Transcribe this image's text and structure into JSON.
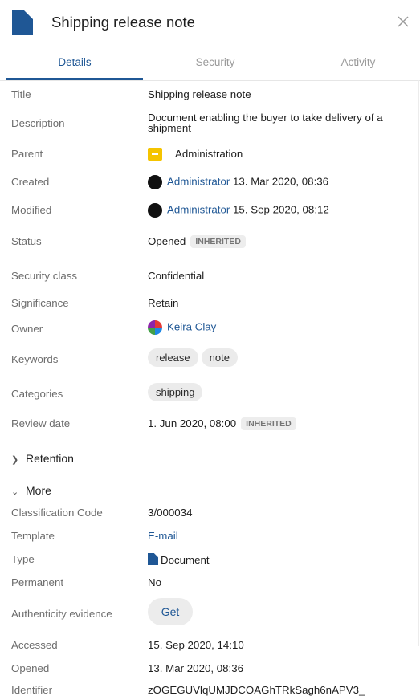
{
  "header": {
    "title": "Shipping release note"
  },
  "tabs": [
    {
      "label": "Details"
    },
    {
      "label": "Security"
    },
    {
      "label": "Activity"
    }
  ],
  "details": {
    "title": {
      "label": "Title",
      "value": "Shipping release note"
    },
    "description": {
      "label": "Description",
      "line1": "Document enabling the buyer to take delivery of a",
      "line2": "shipment"
    },
    "parent": {
      "label": "Parent",
      "value": "Administration"
    },
    "created": {
      "label": "Created",
      "user": "Administrator",
      "date": "13. Mar 2020, 08:36"
    },
    "modified": {
      "label": "Modified",
      "user": "Administrator",
      "date": "15. Sep 2020, 08:12"
    },
    "status": {
      "label": "Status",
      "value": "Opened",
      "badge": "INHERITED"
    },
    "security_class": {
      "label": "Security class",
      "value": "Confidential"
    },
    "significance": {
      "label": "Significance",
      "value": "Retain"
    },
    "owner": {
      "label": "Owner",
      "value": "Keira Clay"
    },
    "keywords": {
      "label": "Keywords",
      "items": [
        "release",
        "note"
      ]
    },
    "categories": {
      "label": "Categories",
      "items": [
        "shipping"
      ]
    },
    "review_date": {
      "label": "Review date",
      "value": "1. Jun 2020, 08:00",
      "badge": "INHERITED"
    }
  },
  "sections": {
    "retention": "Retention",
    "more": "More"
  },
  "more": {
    "classification_code": {
      "label": "Classification Code",
      "value": "3/000034"
    },
    "template": {
      "label": "Template",
      "value": "E-mail"
    },
    "type": {
      "label": "Type",
      "value": "Document"
    },
    "permanent": {
      "label": "Permanent",
      "value": "No"
    },
    "authenticity": {
      "label": "Authenticity evidence",
      "button": "Get"
    },
    "accessed": {
      "label": "Accessed",
      "value": "15. Sep 2020, 14:10"
    },
    "opened": {
      "label": "Opened",
      "value": "13. Mar 2020, 08:36"
    },
    "identifier": {
      "label": "Identifier",
      "value": "zOGEGUVlqUMJDCOAGhTRkSagh6nAPV3_"
    }
  },
  "colors": {
    "accent": "#1f5795",
    "folder": "#f5c400"
  },
  "icons": {
    "document": "document-icon",
    "close": "close-icon",
    "folder": "folder-icon"
  }
}
